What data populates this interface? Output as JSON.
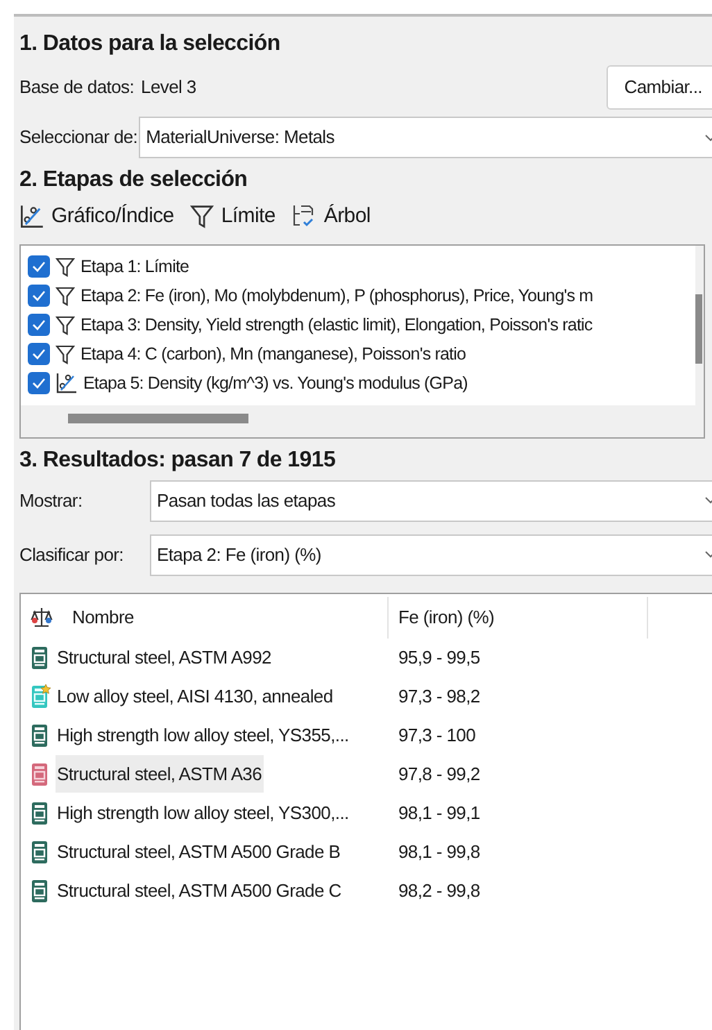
{
  "section1": {
    "title": "1. Datos para la selección",
    "database_label": "Base de datos:",
    "database_value": "Level 3",
    "change_button": "Cambiar...",
    "select_from_label": "Seleccionar de:",
    "select_from_value": "MaterialUniverse: Metals"
  },
  "section2": {
    "title": "2. Etapas de selección",
    "toolbar": [
      {
        "kind": "chart",
        "label": "Gráfico/Índice"
      },
      {
        "kind": "limit",
        "label": "Límite"
      },
      {
        "kind": "tree",
        "label": "Árbol"
      }
    ],
    "stages": [
      {
        "kind": "limit",
        "checked": true,
        "label": "Etapa 1: Límite"
      },
      {
        "kind": "limit",
        "checked": true,
        "label": "Etapa 2: Fe (iron), Mo (molybdenum), P (phosphorus), Price, Young's m"
      },
      {
        "kind": "limit",
        "checked": true,
        "label": "Etapa 3: Density, Yield strength (elastic limit), Elongation, Poisson's ratic"
      },
      {
        "kind": "limit",
        "checked": true,
        "label": "Etapa 4: C (carbon), Mn (manganese), Poisson's ratio"
      },
      {
        "kind": "chart",
        "checked": true,
        "label": "Etapa 5: Density (kg/m^3) vs. Young's modulus (GPa)"
      }
    ]
  },
  "section3": {
    "title": "3. Resultados: pasan 7 de 1915",
    "show_label": "Mostrar:",
    "show_value": "Pasan todas las etapas",
    "sort_label": "Clasificar por:",
    "sort_value": "Etapa 2: Fe (iron) (%)",
    "table": {
      "columns": [
        "Nombre",
        "Fe (iron) (%)"
      ],
      "rows": [
        {
          "kind": "standard",
          "selected": false,
          "name": "Structural steel, ASTM A992",
          "value": "95,9 - 99,5"
        },
        {
          "kind": "favorite",
          "selected": false,
          "name": "Low alloy steel, AISI 4130, annealed",
          "value": "97,3 - 98,2"
        },
        {
          "kind": "standard",
          "selected": false,
          "name": "High strength low alloy steel, YS355,...",
          "value": "97,3 - 100"
        },
        {
          "kind": "flagged",
          "selected": true,
          "name": "Structural steel, ASTM A36",
          "value": "97,8 - 99,2"
        },
        {
          "kind": "standard",
          "selected": false,
          "name": "High strength low alloy steel, YS300,...",
          "value": "98,1 - 99,1"
        },
        {
          "kind": "standard",
          "selected": false,
          "name": "Structural steel, ASTM A500 Grade B",
          "value": "98,1 - 99,8"
        },
        {
          "kind": "standard",
          "selected": false,
          "name": "Structural steel, ASTM A500 Grade C",
          "value": "98,2 - 99,8"
        }
      ]
    }
  }
}
